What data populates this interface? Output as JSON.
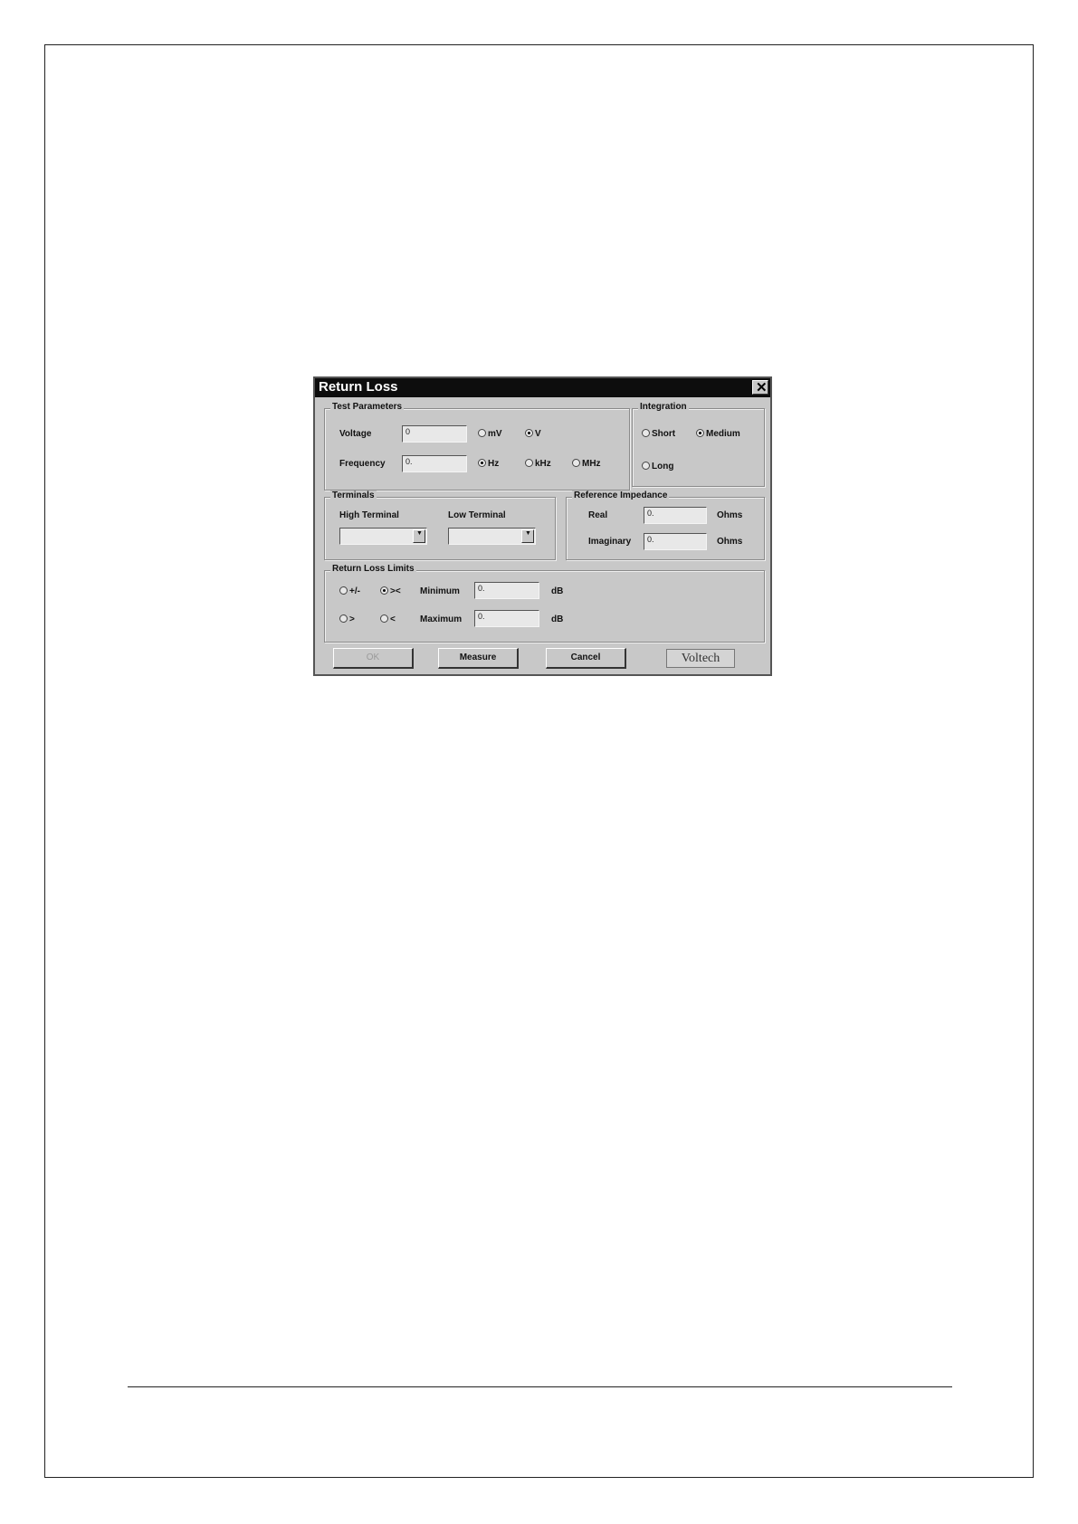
{
  "dialog": {
    "title": "Return Loss",
    "close_symbol": "✕"
  },
  "test_parameters": {
    "legend": "Test Parameters",
    "voltage_label": "Voltage",
    "voltage_value": "0",
    "voltage_units": [
      {
        "label": "mV",
        "selected": false
      },
      {
        "label": "V",
        "selected": true
      }
    ],
    "frequency_label": "Frequency",
    "frequency_value": "0.",
    "frequency_units": [
      {
        "label": "Hz",
        "selected": true
      },
      {
        "label": "kHz",
        "selected": false
      },
      {
        "label": "MHz",
        "selected": false
      }
    ]
  },
  "integration": {
    "legend": "Integration",
    "options": [
      {
        "label": "Short",
        "selected": false
      },
      {
        "label": "Medium",
        "selected": true
      },
      {
        "label": "Long",
        "selected": false
      }
    ]
  },
  "terminals": {
    "legend": "Terminals",
    "high_label": "High Terminal",
    "high_value": "",
    "low_label": "Low Terminal",
    "low_value": ""
  },
  "reference_impedance": {
    "legend": "Reference Impedance",
    "real_label": "Real",
    "real_value": "0.",
    "imaginary_label": "Imaginary",
    "imaginary_value": "0.",
    "unit": "Ohms"
  },
  "limits": {
    "legend": "Return Loss Limits",
    "modes": [
      {
        "label": "+/-",
        "selected": false
      },
      {
        "label": "><",
        "selected": true
      },
      {
        "label": ">",
        "selected": false
      },
      {
        "label": "<",
        "selected": false
      }
    ],
    "minimum_label": "Minimum",
    "minimum_value": "0.",
    "maximum_label": "Maximum",
    "maximum_value": "0.",
    "unit": "dB"
  },
  "buttons": {
    "ok": "OK",
    "measure": "Measure",
    "cancel": "Cancel",
    "brand": "Voltech"
  }
}
